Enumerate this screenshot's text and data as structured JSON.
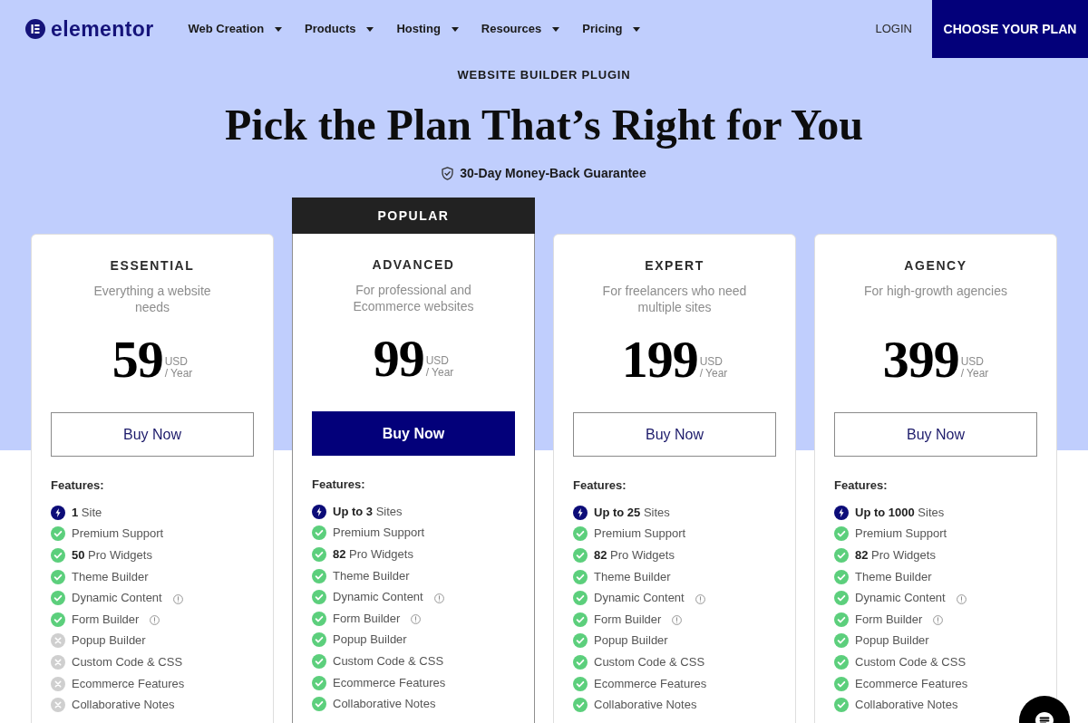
{
  "nav": {
    "logo": "elementor",
    "menu": [
      {
        "label": "Web Creation"
      },
      {
        "label": "Products"
      },
      {
        "label": "Hosting"
      },
      {
        "label": "Resources"
      },
      {
        "label": "Pricing"
      }
    ],
    "login": "LOGIN",
    "cta": "CHOOSE YOUR PLAN"
  },
  "hero": {
    "eyebrow": "WEBSITE BUILDER PLUGIN",
    "title": "Pick the Plan That’s Right for You",
    "guarantee": "30-Day Money-Back Guarantee"
  },
  "plans": [
    {
      "name": "ESSENTIAL",
      "description": "Everything a website needs",
      "price": "59",
      "currency": "USD",
      "period": "/ Year",
      "button": "Buy Now",
      "highlighted": false,
      "features_label": "Features:",
      "features": [
        {
          "kind": "limit",
          "text": "**1** Site",
          "info": false
        },
        {
          "kind": "included",
          "text": "Premium Support",
          "info": false
        },
        {
          "kind": "included",
          "text": "**50** Pro Widgets",
          "info": false
        },
        {
          "kind": "included",
          "text": "Theme Builder",
          "info": false
        },
        {
          "kind": "included",
          "text": "Dynamic Content",
          "info": true
        },
        {
          "kind": "included",
          "text": "Form Builder",
          "info": true
        },
        {
          "kind": "excluded",
          "text": "Popup Builder",
          "info": false
        },
        {
          "kind": "excluded",
          "text": "Custom Code & CSS",
          "info": false
        },
        {
          "kind": "excluded",
          "text": "Ecommerce Features",
          "info": false
        },
        {
          "kind": "excluded",
          "text": "Collaborative Notes",
          "info": false
        }
      ]
    },
    {
      "badge": "POPULAR",
      "name": "ADVANCED",
      "description": "For professional and Ecommerce websites",
      "price": "99",
      "currency": "USD",
      "period": "/ Year",
      "button": "Buy Now",
      "highlighted": true,
      "features_label": "Features:",
      "features": [
        {
          "kind": "limit",
          "text": "**Up to 3** Sites",
          "info": false
        },
        {
          "kind": "included",
          "text": "Premium Support",
          "info": false
        },
        {
          "kind": "included",
          "text": "**82** Pro Widgets",
          "info": false
        },
        {
          "kind": "included",
          "text": "Theme Builder",
          "info": false
        },
        {
          "kind": "included",
          "text": "Dynamic Content",
          "info": true
        },
        {
          "kind": "included",
          "text": "Form Builder",
          "info": true
        },
        {
          "kind": "included",
          "text": "Popup Builder",
          "info": false
        },
        {
          "kind": "included",
          "text": "Custom Code & CSS",
          "info": false
        },
        {
          "kind": "included",
          "text": "Ecommerce Features",
          "info": false
        },
        {
          "kind": "included",
          "text": "Collaborative Notes",
          "info": false
        }
      ]
    },
    {
      "name": "EXPERT",
      "description": "For freelancers who need multiple sites",
      "price": "199",
      "currency": "USD",
      "period": "/ Year",
      "button": "Buy Now",
      "highlighted": false,
      "features_label": "Features:",
      "features": [
        {
          "kind": "limit",
          "text": "**Up to 25** Sites",
          "info": false
        },
        {
          "kind": "included",
          "text": "Premium Support",
          "info": false
        },
        {
          "kind": "included",
          "text": "**82** Pro Widgets",
          "info": false
        },
        {
          "kind": "included",
          "text": "Theme Builder",
          "info": false
        },
        {
          "kind": "included",
          "text": "Dynamic Content",
          "info": true
        },
        {
          "kind": "included",
          "text": "Form Builder",
          "info": true
        },
        {
          "kind": "included",
          "text": "Popup Builder",
          "info": false
        },
        {
          "kind": "included",
          "text": "Custom Code & CSS",
          "info": false
        },
        {
          "kind": "included",
          "text": "Ecommerce Features",
          "info": false
        },
        {
          "kind": "included",
          "text": "Collaborative Notes",
          "info": false
        }
      ]
    },
    {
      "name": "AGENCY",
      "description": "For high-growth agencies",
      "price": "399",
      "currency": "USD",
      "period": "/ Year",
      "button": "Buy Now",
      "highlighted": false,
      "features_label": "Features:",
      "features": [
        {
          "kind": "limit",
          "text": "**Up to 1000** Sites",
          "info": false
        },
        {
          "kind": "included",
          "text": "Premium Support",
          "info": false
        },
        {
          "kind": "included",
          "text": "**82** Pro Widgets",
          "info": false
        },
        {
          "kind": "included",
          "text": "Theme Builder",
          "info": false
        },
        {
          "kind": "included",
          "text": "Dynamic Content",
          "info": true
        },
        {
          "kind": "included",
          "text": "Form Builder",
          "info": true
        },
        {
          "kind": "included",
          "text": "Popup Builder",
          "info": false
        },
        {
          "kind": "included",
          "text": "Custom Code & CSS",
          "info": false
        },
        {
          "kind": "included",
          "text": "Ecommerce Features",
          "info": false
        },
        {
          "kind": "included",
          "text": "Collaborative Notes",
          "info": false
        }
      ]
    }
  ]
}
